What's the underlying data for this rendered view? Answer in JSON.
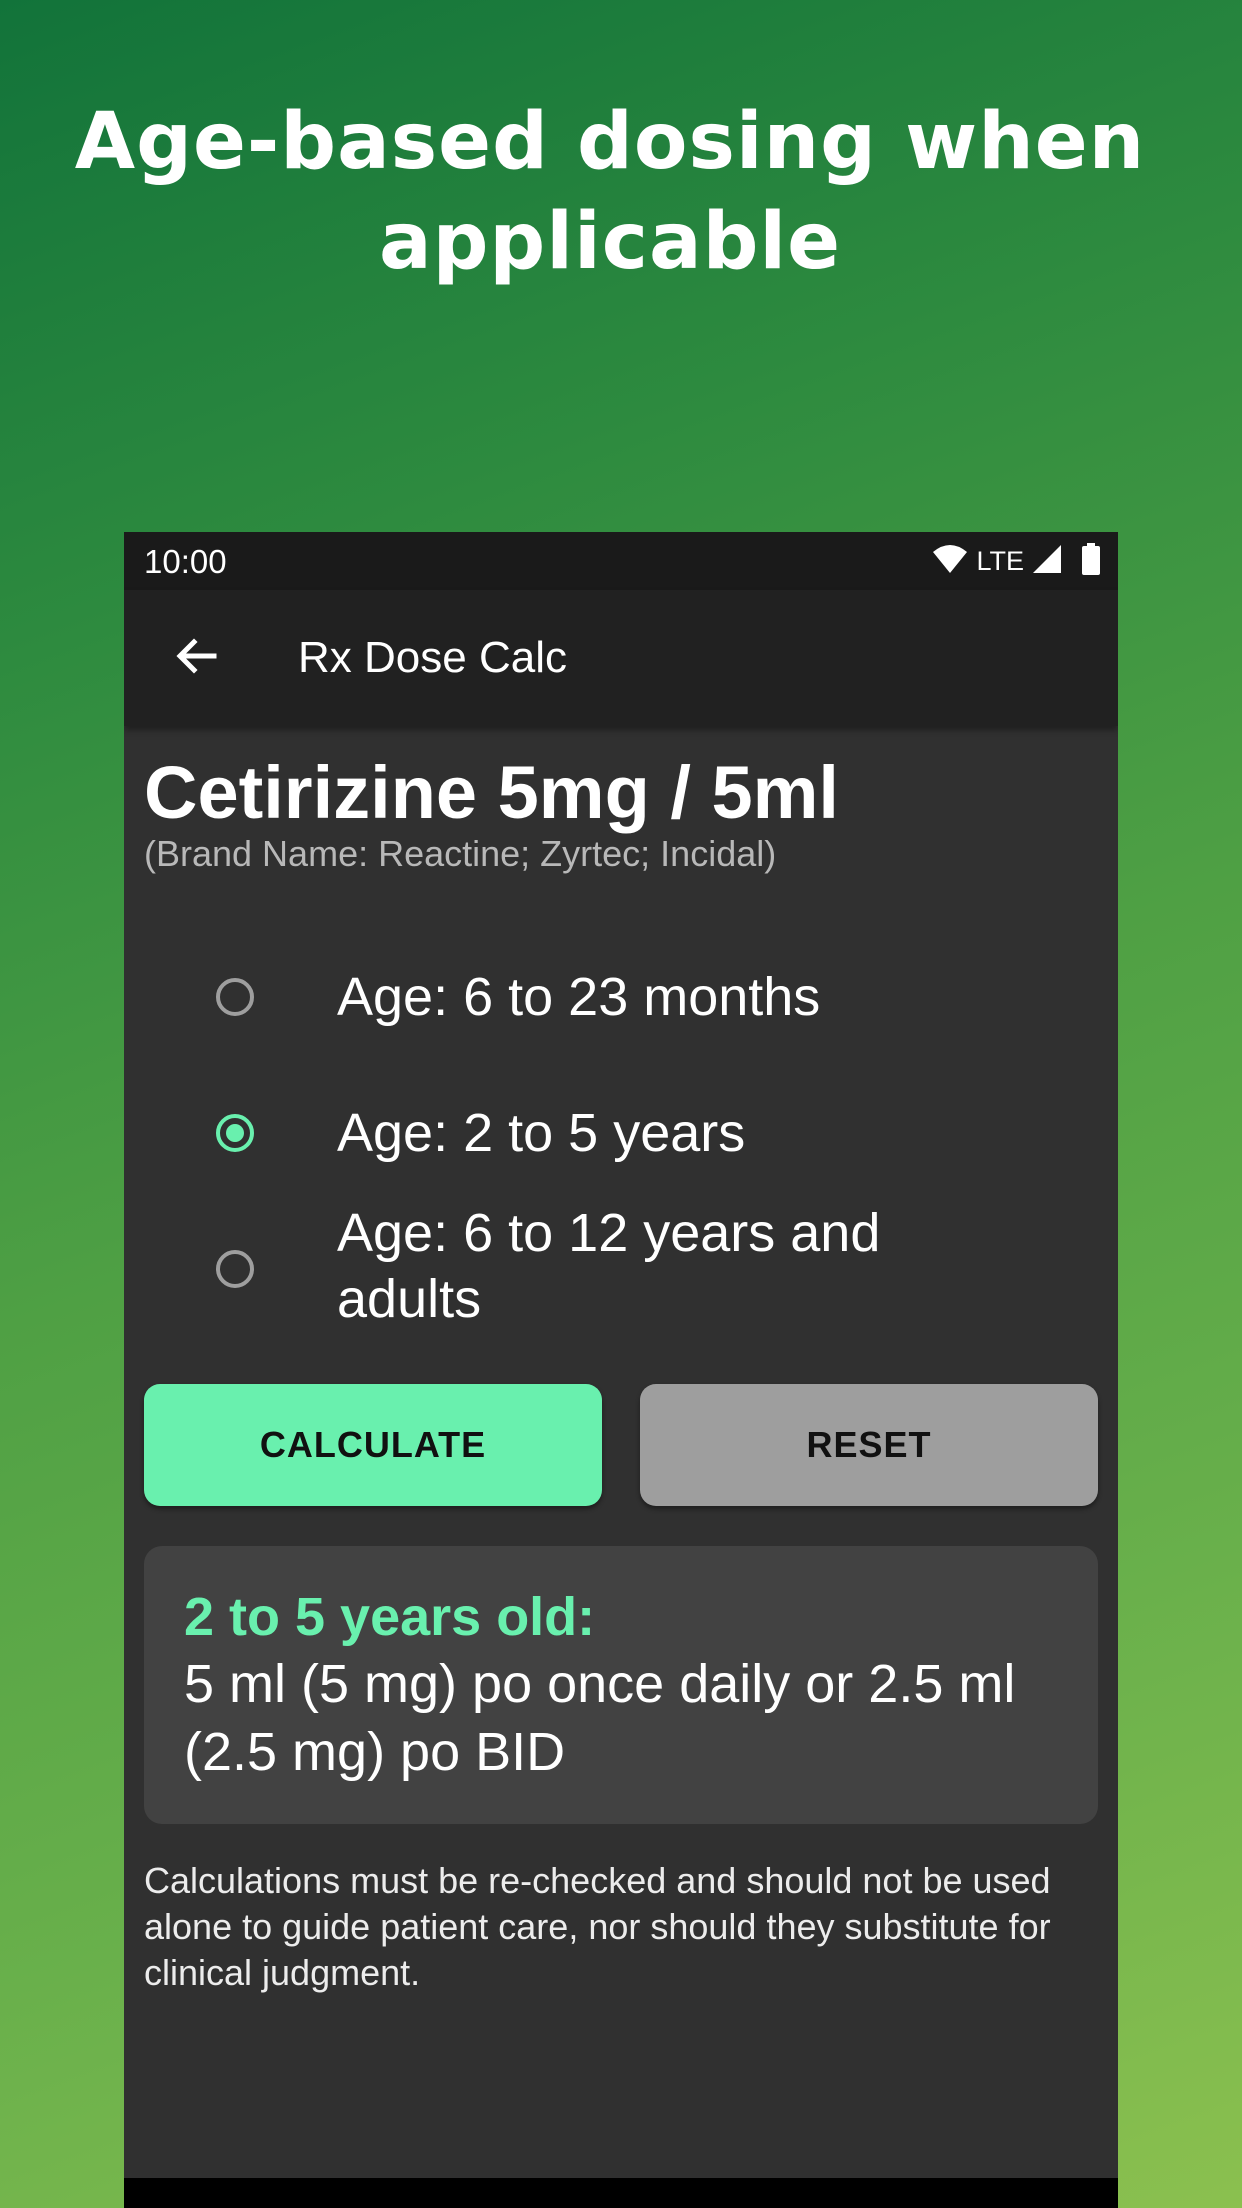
{
  "promo": {
    "headline_line1": "Age-based dosing when",
    "headline_line2": "applicable"
  },
  "status_bar": {
    "time": "10:00",
    "network": "LTE",
    "icons": [
      "wifi-icon",
      "signal-icon",
      "battery-icon"
    ]
  },
  "app_bar": {
    "title": "Rx Dose Calc",
    "back_icon": "arrow-back-icon"
  },
  "drug": {
    "title": "Cetirizine 5mg / 5ml",
    "brand_names": "(Brand Name: Reactine; Zyrtec; Incidal)"
  },
  "age_options": {
    "option_1": {
      "label": "Age: 6 to 23 months",
      "selected": false
    },
    "option_2": {
      "label": "Age: 2 to 5 years",
      "selected": true
    },
    "option_3": {
      "label": "Age: 6 to 12 years and adults",
      "selected": false
    }
  },
  "buttons": {
    "calculate_label": "CALCULATE",
    "reset_label": "RESET"
  },
  "result": {
    "heading": "2 to 5 years old:",
    "text": "5 ml (5 mg) po once daily or 2.5 ml (2.5 mg) po BID"
  },
  "disclaimer": "Calculations must be re-checked and should not be used alone to guide patient care, nor should they substitute for clinical judgment.",
  "colors": {
    "accent": "#69f0ae",
    "background": "#303030",
    "app_bar": "#212121",
    "reset_button": "#9e9e9e",
    "result_card": "#424242"
  }
}
